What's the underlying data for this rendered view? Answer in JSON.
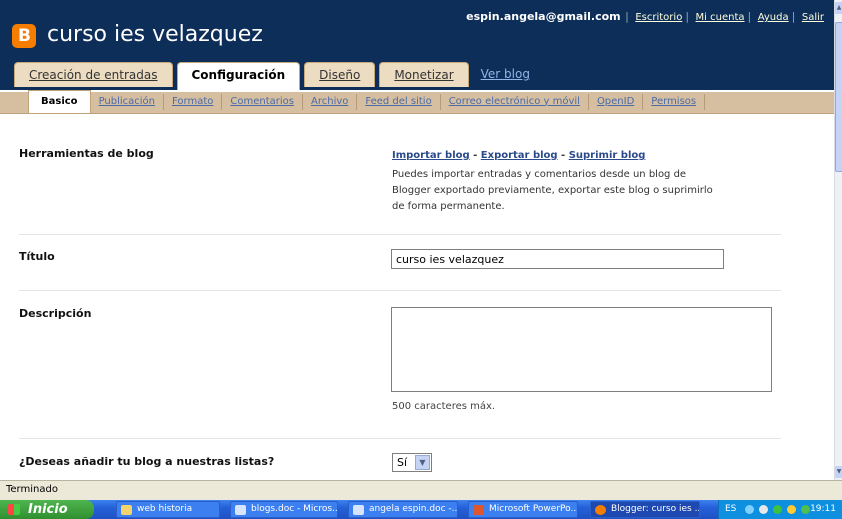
{
  "header": {
    "logo_letter": "B",
    "blog_title": "curso ies velazquez",
    "user_email": "espin.angela@gmail.com",
    "links": [
      "Escritorio",
      "Mi cuenta",
      "Ayuda",
      "Salir"
    ]
  },
  "main_tabs": [
    "Creación de entradas",
    "Configuración",
    "Diseño",
    "Monetizar",
    "Ver blog"
  ],
  "sub_tabs": [
    "Basico",
    "Publicación",
    "Formato",
    "Comentarios",
    "Archivo",
    "Feed del sitio",
    "Correo electrónico y móvil",
    "OpenID",
    "Permisos"
  ],
  "settings": {
    "tools_label": "Herramientas de blog",
    "import_link": "Importar blog",
    "export_link": "Exportar blog",
    "delete_link": "Suprimir blog",
    "dash": " - ",
    "tools_note": "Puedes importar entradas y comentarios desde un blog de Blogger exportado previamente, exportar este blog o suprimirlo de forma permanente.",
    "title_label": "Título",
    "title_value": "curso ies velazquez",
    "description_label": "Descripción",
    "description_note": "500 caracteres máx.",
    "listing_label": "¿Deseas añadir tu blog a nuestras listas?",
    "listing_value": "Sí"
  },
  "status_bar": "Terminado",
  "taskbar": {
    "start_label": "Inicio",
    "items": [
      "web historia",
      "blogs.doc - Micros...",
      "angela espin.doc -...",
      "Microsoft PowerPo...",
      "Blogger: curso ies ..."
    ],
    "lang": "ES",
    "clock": "19:11"
  },
  "colors": {
    "header_bg": "#0d2e59",
    "logo": "#f57d00",
    "tab_bg": "#ebdcc2",
    "link": "#2a4a8c"
  }
}
